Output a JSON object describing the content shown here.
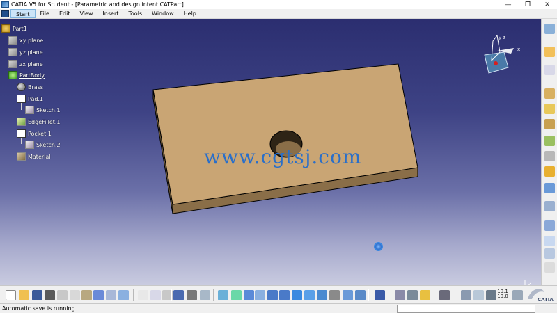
{
  "window": {
    "title": "CATIA V5 for Student - [Parametric and design intent.CATPart]",
    "controls": {
      "minimize": "—",
      "restore": "❐",
      "close": "✕"
    }
  },
  "menubar": {
    "items": [
      {
        "label": "Start",
        "active": true
      },
      {
        "label": "File"
      },
      {
        "label": "Edit"
      },
      {
        "label": "View"
      },
      {
        "label": "Insert"
      },
      {
        "label": "Tools"
      },
      {
        "label": "Window"
      },
      {
        "label": "Help"
      }
    ]
  },
  "tree": {
    "nodes": [
      {
        "label": "Part1",
        "icon": "part-gear-icon"
      },
      {
        "label": "xy plane",
        "icon": "plane-icon"
      },
      {
        "label": "yz plane",
        "icon": "plane-icon"
      },
      {
        "label": "zx plane",
        "icon": "plane-icon"
      },
      {
        "label": "PartBody",
        "icon": "body-gear-icon"
      },
      {
        "label": "Brass",
        "icon": "material-ball-icon"
      },
      {
        "label": "Pad.1",
        "icon": "pad-icon"
      },
      {
        "label": "Sketch.1",
        "icon": "sketch-icon"
      },
      {
        "label": "EdgeFillet.1",
        "icon": "fillet-icon"
      },
      {
        "label": "Pocket.1",
        "icon": "pocket-icon"
      },
      {
        "label": "Sketch.2",
        "icon": "sketch-icon"
      },
      {
        "label": "Material",
        "icon": "material-icon"
      }
    ]
  },
  "viewport": {
    "watermark": "www.cgtsj.com",
    "compass_labels": {
      "x": "x",
      "y": "y",
      "z": "z"
    },
    "part_color": "#c9a574"
  },
  "bottom_toolbar": {
    "grid_readout_top": "10.1",
    "grid_readout_bottom": "10.0"
  },
  "status": {
    "text": "Automatic save is running...",
    "command_value": ""
  },
  "colors": {
    "viewport_top": "#2b2e70",
    "viewport_bottom": "#c9cbe0",
    "watermark": "#2a6fc9",
    "part_face": "#c9a574"
  }
}
